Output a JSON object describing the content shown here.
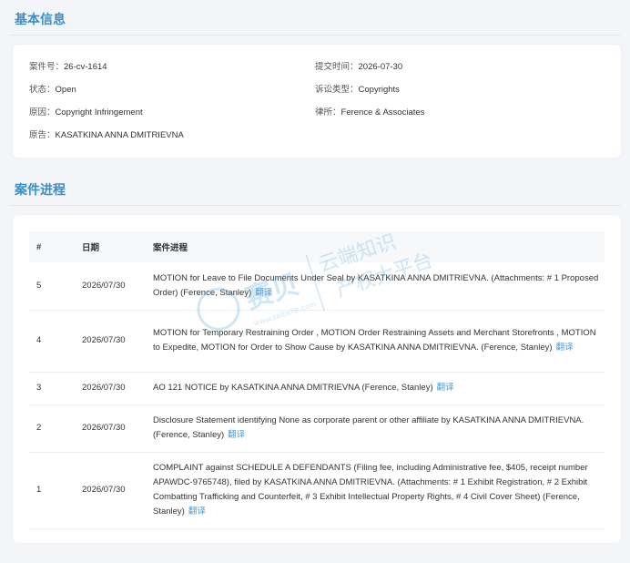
{
  "basic_info": {
    "title": "基本信息",
    "fields_left": [
      {
        "label": "案件号：",
        "value": "26-cv-1614"
      },
      {
        "label": "状态：",
        "value": "Open"
      },
      {
        "label": "原因：",
        "value": "Copyright Infringement"
      },
      {
        "label": "原告：",
        "value": "KASATKINA ANNA DMITRIEVNA"
      }
    ],
    "fields_right": [
      {
        "label": "提交时间：",
        "value": "2026-07-30"
      },
      {
        "label": "诉讼类型：",
        "value": "Copyrights"
      },
      {
        "label": "律所：",
        "value": "Ference & Associates"
      }
    ]
  },
  "progress": {
    "title": "案件进程",
    "headers": [
      "#",
      "日期",
      "案件进程"
    ],
    "translate_label": "翻译",
    "rows": [
      {
        "no": "5",
        "date": "2026/07/30",
        "text": "MOTION for Leave to File Documents Under Seal by KASATKINA ANNA DMITRIEVNA. (Attachments: # 1 Proposed Order) (Ference, Stanley)"
      },
      {
        "no": "4",
        "date": "2026/07/30",
        "text": "MOTION for Temporary Restraining Order , MOTION Order Restraining Assets and Merchant Storefronts , MOTION to Expedite, MOTION for Order to Show Cause by KASATKINA ANNA DMITRIEVNA. (Ference, Stanley)"
      },
      {
        "no": "3",
        "date": "2026/07/30",
        "text": "AO 121 NOTICE by KASATKINA ANNA DMITRIEVNA (Ference, Stanley)"
      },
      {
        "no": "2",
        "date": "2026/07/30",
        "text": "Disclosure Statement identifying None as corporate parent or other affiliate by KASATKINA ANNA DMITRIEVNA. (Ference, Stanley)"
      },
      {
        "no": "1",
        "date": "2026/07/30",
        "text": "COMPLAINT against SCHEDULE A DEFENDANTS (Filing fee, including Administrative fee, $405, receipt number APAWDC-9765748), filed by KASATKINA ANNA DMITRIEVNA. (Attachments: # 1 Exhibit Registration, # 2 Exhibit Combatting Trafficking and Counterfeit, # 3 Exhibit Intellectual Property Rights, # 4 Civil Cover Sheet) (Ference, Stanley)"
      }
    ]
  },
  "watermark": {
    "brand": "赛贝",
    "slogan_line1": "云端知识",
    "slogan_line2": "产权大平台",
    "url": "www.saibeiip.com"
  },
  "colors": {
    "accent": "#3a8fc7",
    "link": "#4a9bd4",
    "background": "#f3f5f8"
  }
}
